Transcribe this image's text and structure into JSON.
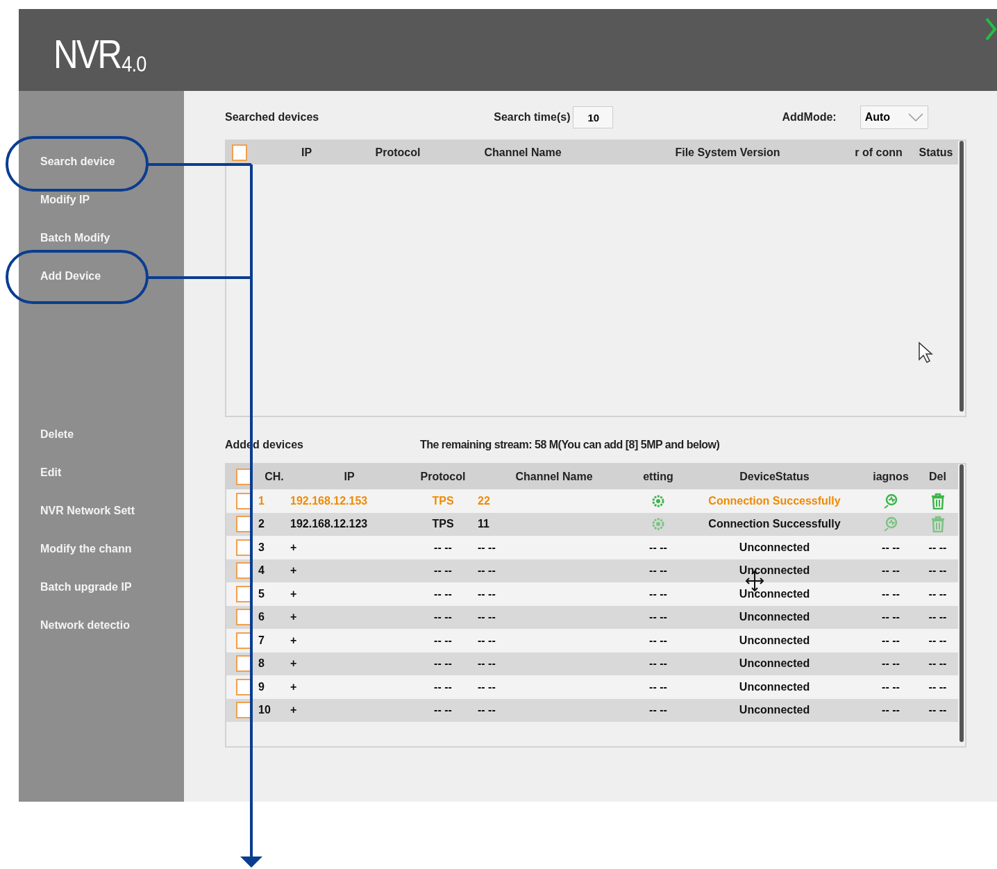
{
  "app": {
    "logo": "NVR",
    "version": "4.0"
  },
  "sidebar": {
    "top_items": [
      {
        "label": "Search device"
      },
      {
        "label": "Modify IP"
      },
      {
        "label": "Batch Modify"
      },
      {
        "label": "Add Device"
      }
    ],
    "bottom_items": [
      {
        "label": "Delete"
      },
      {
        "label": "Edit"
      },
      {
        "label": "NVR Network Sett"
      },
      {
        "label": "Modify the chann"
      },
      {
        "label": "Batch upgrade IP"
      },
      {
        "label": "Network detectio"
      }
    ]
  },
  "search": {
    "title": "Searched devices",
    "time_label": "Search time(s)",
    "time_value": "10",
    "mode_label": "AddMode:",
    "mode_value": "Auto",
    "all_checked": false,
    "columns": [
      "IP",
      "Protocol",
      "Channel Name",
      "File System Version",
      "r of conn",
      "Status"
    ]
  },
  "added": {
    "title": "Added devices",
    "stream_note": "The remaining stream: 58 M(You can add [8] 5MP and below)",
    "all_checked": false,
    "columns": [
      "CH.",
      "IP",
      "Protocol",
      "Channel Name",
      "etting",
      "DeviceStatus",
      "iagnos",
      "Del"
    ],
    "rows": [
      {
        "kind": "connected",
        "selected": true,
        "ch": "1",
        "ip": "192.168.12.153",
        "protocol": "TPS",
        "channel_name": "22",
        "status": "Connection Successfully"
      },
      {
        "kind": "connected",
        "selected": false,
        "ch": "2",
        "ip": "192.168.12.123",
        "protocol": "TPS",
        "channel_name": "11",
        "status": "Connection Successfully"
      },
      {
        "kind": "empty",
        "selected": false,
        "ch": "3",
        "ip": "+",
        "protocol": "-- --",
        "channel_name": "-- --",
        "setting": "-- --",
        "status": "Unconnected",
        "diagnose": "-- --",
        "del": "-- --"
      },
      {
        "kind": "empty",
        "selected": false,
        "ch": "4",
        "ip": "+",
        "protocol": "-- --",
        "channel_name": "-- --",
        "setting": "-- --",
        "status": "Unconnected",
        "diagnose": "-- --",
        "del": "-- --"
      },
      {
        "kind": "empty",
        "selected": false,
        "ch": "5",
        "ip": "+",
        "protocol": "-- --",
        "channel_name": "-- --",
        "setting": "-- --",
        "status": "Unconnected",
        "diagnose": "-- --",
        "del": "-- --"
      },
      {
        "kind": "empty",
        "selected": false,
        "ch": "6",
        "ip": "+",
        "protocol": "-- --",
        "channel_name": "-- --",
        "setting": "-- --",
        "status": "Unconnected",
        "diagnose": "-- --",
        "del": "-- --"
      },
      {
        "kind": "empty",
        "selected": false,
        "ch": "7",
        "ip": "+",
        "protocol": "-- --",
        "channel_name": "-- --",
        "setting": "-- --",
        "status": "Unconnected",
        "diagnose": "-- --",
        "del": "-- --"
      },
      {
        "kind": "empty",
        "selected": false,
        "ch": "8",
        "ip": "+",
        "protocol": "-- --",
        "channel_name": "-- --",
        "setting": "-- --",
        "status": "Unconnected",
        "diagnose": "-- --",
        "del": "-- --"
      },
      {
        "kind": "empty",
        "selected": false,
        "ch": "9",
        "ip": "+",
        "protocol": "-- --",
        "channel_name": "-- --",
        "setting": "-- --",
        "status": "Unconnected",
        "diagnose": "-- --",
        "del": "-- --"
      },
      {
        "kind": "empty",
        "selected": false,
        "ch": "10",
        "ip": "+",
        "protocol": "-- --",
        "channel_name": "-- --",
        "setting": "-- --",
        "status": "Unconnected",
        "diagnose": "-- --",
        "del": "-- --"
      }
    ]
  }
}
